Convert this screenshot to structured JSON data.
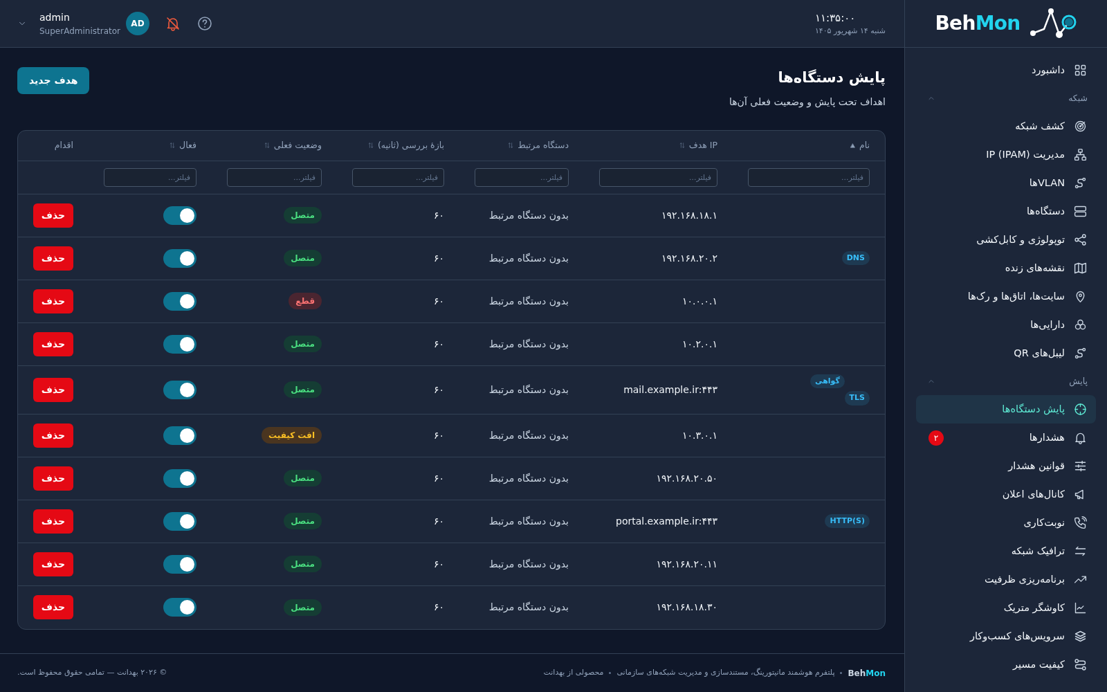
{
  "header": {
    "user": {
      "name": "admin",
      "role": "SuperAdministrator",
      "initials": "AD"
    },
    "clock": {
      "time": "۱۱:۳۵:۰۰",
      "date": "شنبه ۱۴ شهریور ۱۴۰۵"
    }
  },
  "logo": {
    "part_1": "Beh",
    "part_2": "Mon"
  },
  "sidebar": {
    "items": [
      {
        "label": "داشبورد",
        "selected": false
      }
    ],
    "sections": [
      {
        "title": "شبکه",
        "expanded": true,
        "items": [
          {
            "label": "کشف شبکه",
            "selected": false
          },
          {
            "label": "مدیریت IP (IPAM)",
            "selected": false
          },
          {
            "label": "VLANها",
            "selected": false
          },
          {
            "label": "دستگاه‌ها",
            "selected": false
          },
          {
            "label": "توپولوژی و کابل‌کشی",
            "selected": false
          },
          {
            "label": "نقشه‌های زنده",
            "selected": false
          },
          {
            "label": "سایت‌ها، اتاق‌ها و رک‌ها",
            "selected": false
          },
          {
            "label": "دارایی‌ها",
            "selected": false
          },
          {
            "label": "لیبل‌های QR",
            "selected": false
          }
        ]
      },
      {
        "title": "پایش",
        "expanded": true,
        "items": [
          {
            "label": "پایش دستگاه‌ها",
            "selected": true
          },
          {
            "label": "هشدارها",
            "selected": false,
            "badge": "۲"
          },
          {
            "label": "قوانین هشدار",
            "selected": false
          },
          {
            "label": "کانال‌های اعلان",
            "selected": false
          },
          {
            "label": "نوبت‌کاری",
            "selected": false
          },
          {
            "label": "ترافیک شبکه",
            "selected": false
          },
          {
            "label": "برنامه‌ریزی ظرفیت",
            "selected": false
          },
          {
            "label": "کاوشگر متریک",
            "selected": false
          },
          {
            "label": "سرویس‌های کسب‌وکار",
            "selected": false
          },
          {
            "label": "کیفیت مسیر",
            "selected": false
          }
        ]
      }
    ]
  },
  "page": {
    "title": "پایش دستگاه‌ها",
    "subtitle": "اهداف تحت پایش و وضعیت فعلی آن‌ها",
    "new_button": "هدف جدید"
  },
  "table": {
    "columns": [
      {
        "label": "نام",
        "sorted": true,
        "filter_placeholder": "فیلتر..."
      },
      {
        "label": "IP هدف",
        "sorted": false,
        "filter_placeholder": "فیلتر..."
      },
      {
        "label": "دستگاه مرتبط",
        "sorted": false,
        "filter_placeholder": "فیلتر..."
      },
      {
        "label": "بازهٔ بررسی (ثانیه)",
        "sorted": false,
        "filter_placeholder": "فیلتر..."
      },
      {
        "label": "وضعیت فعلی",
        "sorted": false,
        "filter_placeholder": "فیلتر..."
      },
      {
        "label": "فعال",
        "sorted": false,
        "filter_placeholder": "فیلتر..."
      },
      {
        "label": "اقدام"
      }
    ],
    "rows": [
      {
        "tags": [],
        "ip": "۱۹۲.۱۶۸.۱۸.۱",
        "device": "بدون دستگاه مرتبط",
        "interval": "۶۰",
        "status": {
          "kind": "up",
          "label": "متصل"
        },
        "on": true,
        "action": "حذف"
      },
      {
        "tags": [
          "DNS"
        ],
        "ip": "۱۹۲.۱۶۸.۲۰.۲",
        "device": "بدون دستگاه مرتبط",
        "interval": "۶۰",
        "status": {
          "kind": "up",
          "label": "متصل"
        },
        "on": true,
        "action": "حذف"
      },
      {
        "tags": [],
        "ip": "۱۰.۰.۰.۱",
        "device": "بدون دستگاه مرتبط",
        "interval": "۶۰",
        "status": {
          "kind": "down",
          "label": "قطع"
        },
        "on": true,
        "action": "حذف"
      },
      {
        "tags": [],
        "ip": "۱۰.۲.۰.۱",
        "device": "بدون دستگاه مرتبط",
        "interval": "۶۰",
        "status": {
          "kind": "up",
          "label": "متصل"
        },
        "on": true,
        "action": "حذف"
      },
      {
        "tags": [
          "TLS",
          "گواهی"
        ],
        "ip": "mail.example.ir:۴۴۳",
        "device": "بدون دستگاه مرتبط",
        "interval": "۶۰",
        "status": {
          "kind": "up",
          "label": "متصل"
        },
        "on": true,
        "action": "حذف"
      },
      {
        "tags": [],
        "ip": "۱۰.۳.۰.۱",
        "device": "بدون دستگاه مرتبط",
        "interval": "۶۰",
        "status": {
          "kind": "degraded",
          "label": "افت کیفیت"
        },
        "on": true,
        "action": "حذف"
      },
      {
        "tags": [],
        "ip": "۱۹۲.۱۶۸.۲۰.۵۰",
        "device": "بدون دستگاه مرتبط",
        "interval": "۶۰",
        "status": {
          "kind": "up",
          "label": "متصل"
        },
        "on": true,
        "action": "حذف"
      },
      {
        "tags": [
          "HTTP(S)"
        ],
        "ip": "portal.example.ir:۴۴۳",
        "device": "بدون دستگاه مرتبط",
        "interval": "۶۰",
        "status": {
          "kind": "up",
          "label": "متصل"
        },
        "on": true,
        "action": "حذف"
      },
      {
        "tags": [],
        "ip": "۱۹۲.۱۶۸.۲۰.۱۱",
        "device": "بدون دستگاه مرتبط",
        "interval": "۶۰",
        "status": {
          "kind": "up",
          "label": "متصل"
        },
        "on": true,
        "action": "حذف"
      },
      {
        "tags": [],
        "ip": "۱۹۲.۱۶۸.۱۸.۳۰",
        "device": "بدون دستگاه مرتبط",
        "interval": "۶۰",
        "status": {
          "kind": "up",
          "label": "متصل"
        },
        "on": true,
        "action": "حذف"
      }
    ]
  },
  "footer": {
    "brand": {
      "part_1": "Beh",
      "part_2": "Mon"
    },
    "tagline": "پلتفرم هوشمند مانیتورینگ، مستندسازی و مدیریت شبکه‌های سازمانی",
    "credit": "محصولی از بهدانت",
    "copyright": "© ۲۰۲۶ بهدانت — تمامی حقوق محفوظ است."
  }
}
